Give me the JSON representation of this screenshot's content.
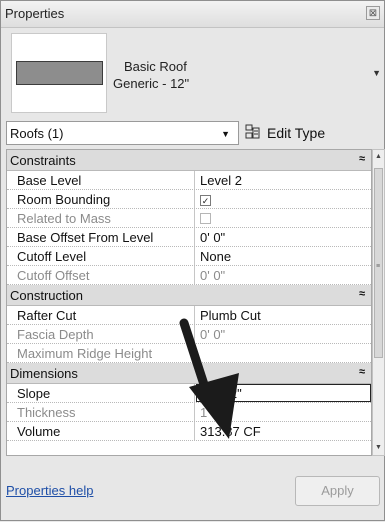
{
  "window": {
    "title": "Properties",
    "close_glyph": "⊠"
  },
  "type_selector": {
    "family": "Basic Roof",
    "type": "Generic - 12\"",
    "swatch_color": "#8d8d8d"
  },
  "instance_filter": {
    "label": "Roofs (1)",
    "edit_type_label": "Edit Type"
  },
  "groups": {
    "constraints": {
      "label": "Constraints",
      "rows": {
        "base_level": {
          "name": "Base Level",
          "value": "Level 2"
        },
        "room_bounding": {
          "name": "Room Bounding",
          "checked": true
        },
        "related_to_mass": {
          "name": "Related to Mass",
          "checked": false
        },
        "base_offset": {
          "name": "Base Offset From Level",
          "value": "0'  0\""
        },
        "cutoff_level": {
          "name": "Cutoff Level",
          "value": "None"
        },
        "cutoff_offset": {
          "name": "Cutoff Offset",
          "value": "0'  0\""
        }
      }
    },
    "construction": {
      "label": "Construction",
      "rows": {
        "rafter_cut": {
          "name": "Rafter Cut",
          "value": "Plumb Cut"
        },
        "fascia_depth": {
          "name": "Fascia Depth",
          "value": "0'  0\""
        },
        "max_ridge_height": {
          "name": "Maximum Ridge Height",
          "value": ""
        }
      }
    },
    "dimensions": {
      "label": "Dimensions",
      "rows": {
        "slope": {
          "name": "Slope",
          "value": "3\" / 12\""
        },
        "thickness": {
          "name": "Thickness",
          "value": "1'  0\""
        },
        "volume": {
          "name": "Volume",
          "value": "313.87 CF"
        }
      }
    }
  },
  "footer": {
    "help_link": "Properties help",
    "apply_label": "Apply"
  },
  "icons": {
    "collapse": "≈",
    "dropdown": "▼",
    "scroll_up": "▲",
    "scroll_down": "▼",
    "check": "✓"
  }
}
